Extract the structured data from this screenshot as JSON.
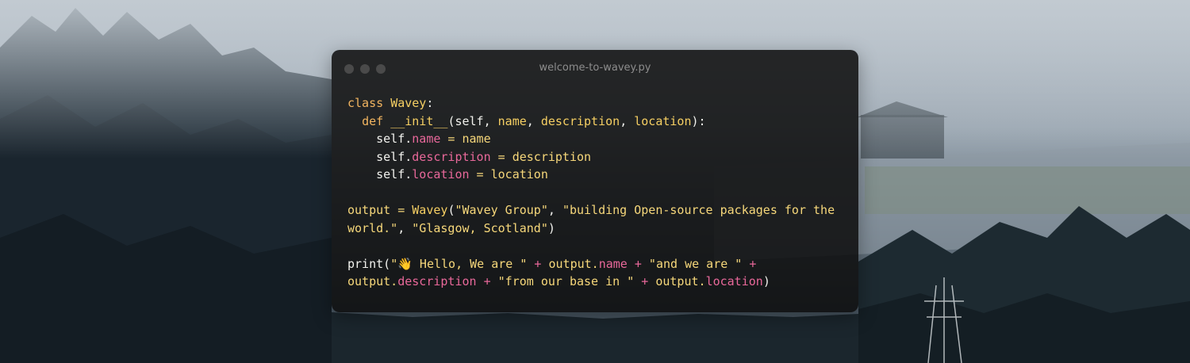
{
  "window": {
    "title": "welcome-to-wavey.py"
  },
  "code": {
    "line1": {
      "kw": "class",
      "name": "Wavey",
      "rest": ":"
    },
    "line2": {
      "indent": "  ",
      "kw": "def",
      "fn": "__init__",
      "args": "(self, ",
      "a1": "name",
      "c1": ", ",
      "a2": "description",
      "c2": ", ",
      "a3": "location",
      "end": "):"
    },
    "line3": {
      "indent": "    ",
      "self": "self.",
      "prop": "name",
      "eq": " = ",
      "val": "name"
    },
    "line4": {
      "indent": "    ",
      "self": "self.",
      "prop": "description",
      "eq": " = ",
      "val": "description"
    },
    "line5": {
      "indent": "    ",
      "self": "self.",
      "prop": "location",
      "eq": " = ",
      "val": "location"
    },
    "line7": {
      "var": "output",
      "eq": " = ",
      "cls": "Wavey",
      "open": "(",
      "s1": "\"Wavey Group\"",
      "c1": ", ",
      "s2a": "\"building Open-source packages for the"
    },
    "line8": {
      "s2b": "world.\"",
      "c2": ", ",
      "s3": "\"Glasgow, Scotland\"",
      "close": ")"
    },
    "line10": {
      "fn": "print",
      "open": "(",
      "s1": "\"👋 Hello, We are \"",
      "op1": " + ",
      "obj1": "output.",
      "p1": "name",
      "op2": " + ",
      "s2": "\"and we are \"",
      "op3": " +"
    },
    "line11": {
      "obj2": "output.",
      "p2": "description",
      "op4": " + ",
      "s3": "\"from our base in \"",
      "op5": " + ",
      "obj3": "output.",
      "p3": "location",
      "close": ")"
    }
  },
  "colors": {
    "keyword": "#f2b460",
    "class_name": "#f6cf63",
    "string": "#f6d77a",
    "property": "#e8689a",
    "text": "#f2f2ee"
  }
}
